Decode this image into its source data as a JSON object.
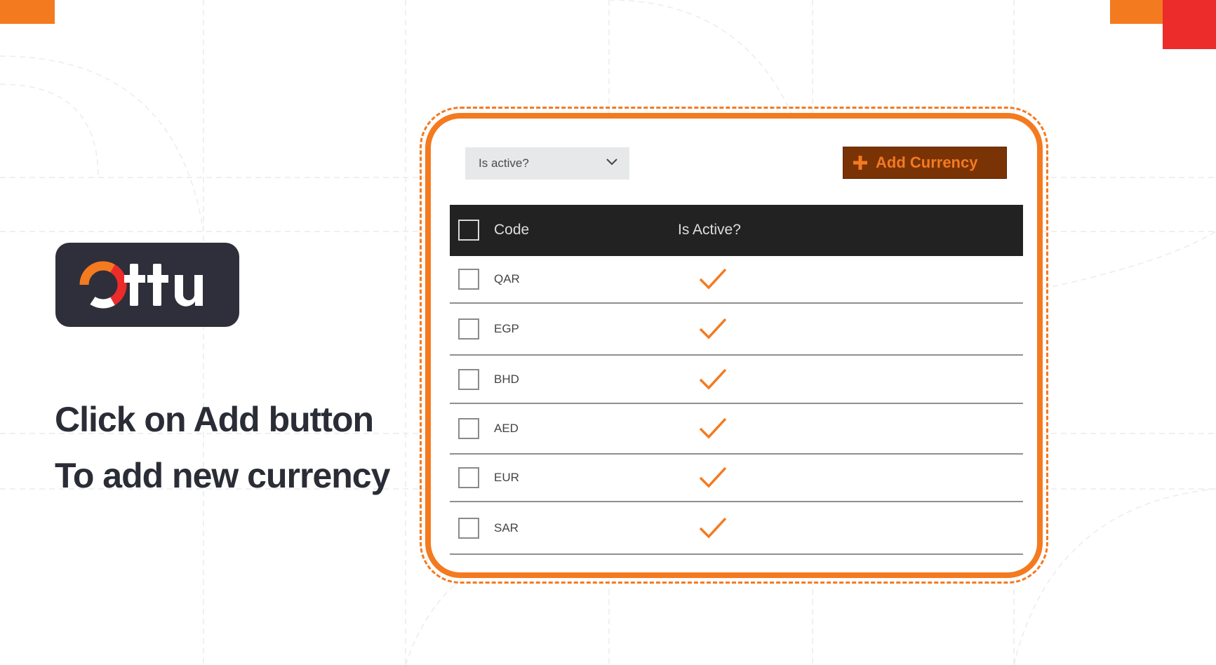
{
  "brand": {
    "logo_text": "Ottu",
    "colors": {
      "orange": "#f47a20",
      "red": "#ec2b2b",
      "dark": "#2e2f3a"
    }
  },
  "instructions": {
    "line1": "Click on Add button",
    "line2": "To add new currency"
  },
  "filter": {
    "label": "Is active?",
    "icon": "chevron-down-icon"
  },
  "add_button": {
    "label": "Add Currency",
    "icon": "plus-icon"
  },
  "table": {
    "headers": {
      "code": "Code",
      "is_active": "Is Active?"
    },
    "rows": [
      {
        "code": "QAR",
        "active": true
      },
      {
        "code": "EGP",
        "active": true
      },
      {
        "code": "BHD",
        "active": true
      },
      {
        "code": "AED",
        "active": true
      },
      {
        "code": "EUR",
        "active": true
      },
      {
        "code": "SAR",
        "active": true
      }
    ]
  }
}
